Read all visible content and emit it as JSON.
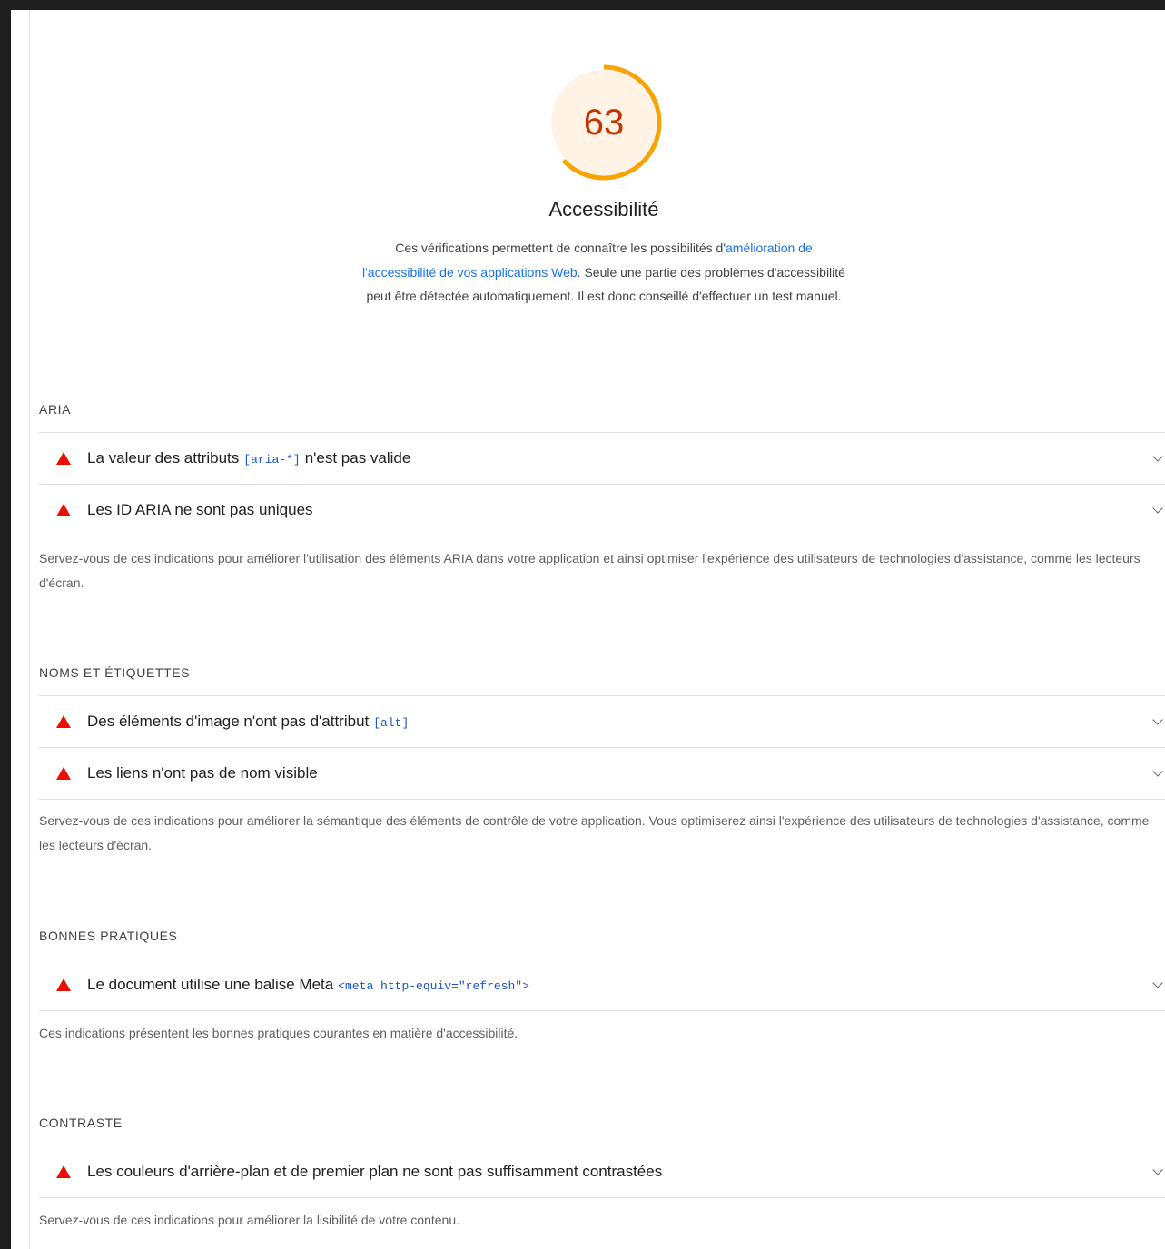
{
  "score": {
    "value": "63",
    "fraction": 0.63,
    "color": "#f8a300",
    "track_fill": "#fff3e6",
    "text_color": "#c33300"
  },
  "category": {
    "title": "Accessibilité",
    "desc_before": "Ces vérifications permettent de connaître les possibilités d'",
    "desc_link": "amélioration de l'accessibilité de vos applications Web",
    "desc_after": ". Seule une partie des problèmes d'accessibilité peut être détectée automatiquement. Il est donc conseillé d'effectuer un test manuel."
  },
  "groups": [
    {
      "title": "ARIA",
      "audits": [
        {
          "before": "La valeur des attributs",
          "code": "[aria-*]",
          "after": "n'est pas valide"
        },
        {
          "before": "Les ID ARIA ne sont pas uniques",
          "code": "",
          "after": ""
        }
      ],
      "description": "Servez-vous de ces indications pour améliorer l'utilisation des éléments ARIA dans votre application et ainsi optimiser l'expérience des utilisateurs de technologies d'assistance, comme les lecteurs d'écran."
    },
    {
      "title": "NOMS ET ÉTIQUETTES",
      "audits": [
        {
          "before": "Des éléments d'image n'ont pas d'attribut",
          "code": "[alt]",
          "after": ""
        },
        {
          "before": "Les liens n'ont pas de nom visible",
          "code": "",
          "after": ""
        }
      ],
      "description": "Servez-vous de ces indications pour améliorer la sémantique des éléments de contrôle de votre application. Vous optimiserez ainsi l'expérience des utilisateurs de technologies d'assistance, comme les lecteurs d'écran."
    },
    {
      "title": "BONNES PRATIQUES",
      "audits": [
        {
          "before": "Le document utilise une balise Meta",
          "code": "<meta http-equiv=\"refresh\">",
          "after": ""
        }
      ],
      "description": "Ces indications présentent les bonnes pratiques courantes en matière d'accessibilité."
    },
    {
      "title": "CONTRASTE",
      "audits": [
        {
          "before": "Les couleurs d'arrière-plan et de premier plan ne sont pas suffisamment contrastées",
          "code": "",
          "after": ""
        }
      ],
      "description": "Servez-vous de ces indications pour améliorer la lisibilité de votre contenu."
    }
  ]
}
